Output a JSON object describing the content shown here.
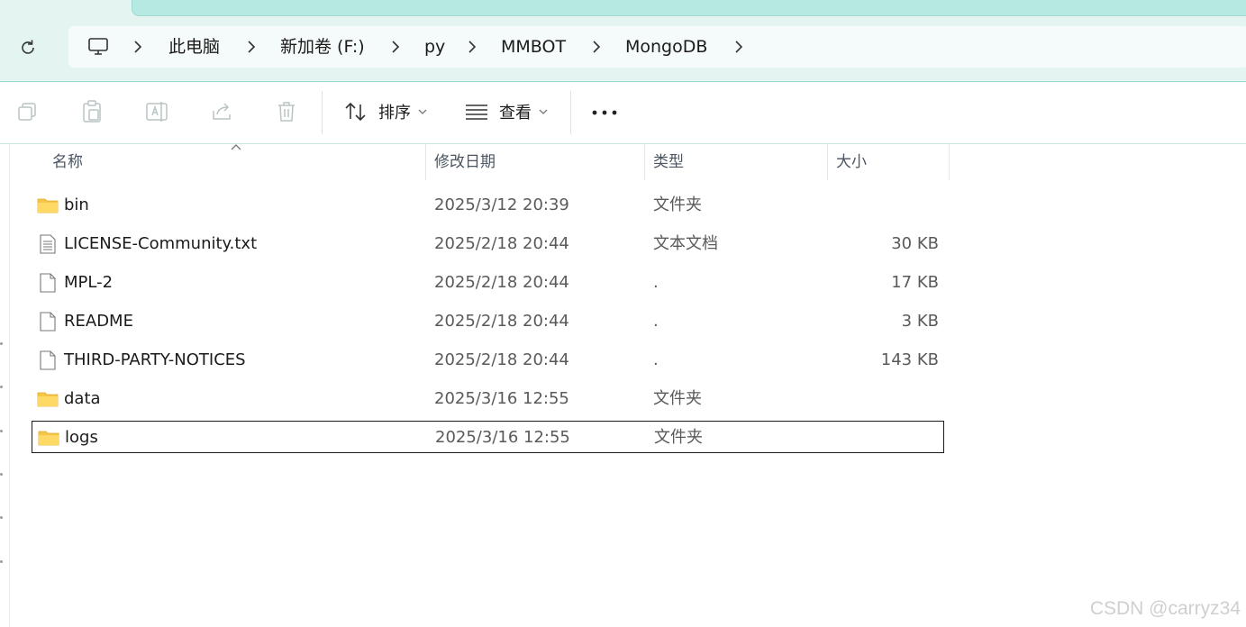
{
  "breadcrumb": {
    "items": [
      "此电脑",
      "新加卷 (F:)",
      "py",
      "MMBOT",
      "MongoDB"
    ]
  },
  "toolbar": {
    "sort_label": "排序",
    "view_label": "查看"
  },
  "columns": {
    "name": "名称",
    "modified": "修改日期",
    "type": "类型",
    "size": "大小"
  },
  "files": [
    {
      "name": "bin",
      "modified": "2025/3/12 20:39",
      "type": "文件夹",
      "size": "",
      "icon": "folder-icon"
    },
    {
      "name": "LICENSE-Community.txt",
      "modified": "2025/2/18 20:44",
      "type": "文本文档",
      "size": "30 KB",
      "icon": "text-file-icon"
    },
    {
      "name": "MPL-2",
      "modified": "2025/2/18 20:44",
      "type": ".",
      "size": "17 KB",
      "icon": "file-icon"
    },
    {
      "name": "README",
      "modified": "2025/2/18 20:44",
      "type": ".",
      "size": "3 KB",
      "icon": "file-icon"
    },
    {
      "name": "THIRD-PARTY-NOTICES",
      "modified": "2025/2/18 20:44",
      "type": ".",
      "size": "143 KB",
      "icon": "file-icon"
    },
    {
      "name": "data",
      "modified": "2025/3/16 12:55",
      "type": "文件夹",
      "size": "",
      "icon": "folder-icon"
    },
    {
      "name": "logs",
      "modified": "2025/3/16 12:55",
      "type": "文件夹",
      "size": "",
      "icon": "folder-icon",
      "selected": true
    }
  ],
  "watermark": "CSDN @carryz34",
  "colors": {
    "chrome_bg": "#e3f4f1",
    "tab_active": "#b6e9e2",
    "folder_yellow": "#f6c646"
  }
}
